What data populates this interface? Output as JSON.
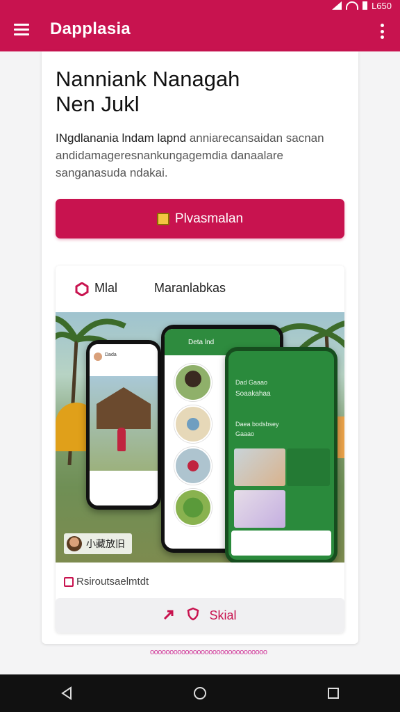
{
  "status_bar": {
    "time": "L650"
  },
  "app_bar": {
    "title": "Dapplasia"
  },
  "headline": "Nanniank Nanagah\nNen Jukl",
  "body": {
    "lead": "INgdlanania lndam lapnd",
    "rest": " anniarecansaidan sacnan andidamageresnankungagemdia danaalare sanganasuda ndakai."
  },
  "primary_button": {
    "label": "Plvasmalan"
  },
  "feature": {
    "tabs": [
      {
        "label": "Mlal",
        "icon": "hexagon-icon"
      },
      {
        "label": "Maranlabkas"
      }
    ],
    "phone_left": {
      "header_text": "Dada"
    },
    "phone_middle": {
      "header_text": "Deta lnd"
    },
    "phone_right": {
      "line1": "Dad Gaaao",
      "line2": "Soaakahaa",
      "line3": "Daea bodsbsey",
      "line4": "Gaaao"
    },
    "hero_caption": "小藏放旧",
    "source_label": "Rsiroutsaelmtdt",
    "share_label": "Skial",
    "share_icons": [
      "share-arrow-icon",
      "shield-icon"
    ]
  },
  "footer_link": "oooooooooooooooooooooooooooooo",
  "nav_bar": {
    "buttons": [
      "back-icon",
      "home-icon",
      "recents-icon"
    ]
  },
  "colors": {
    "accent": "#c8134f",
    "nav": "#111111",
    "green": "#2a8a3c"
  }
}
